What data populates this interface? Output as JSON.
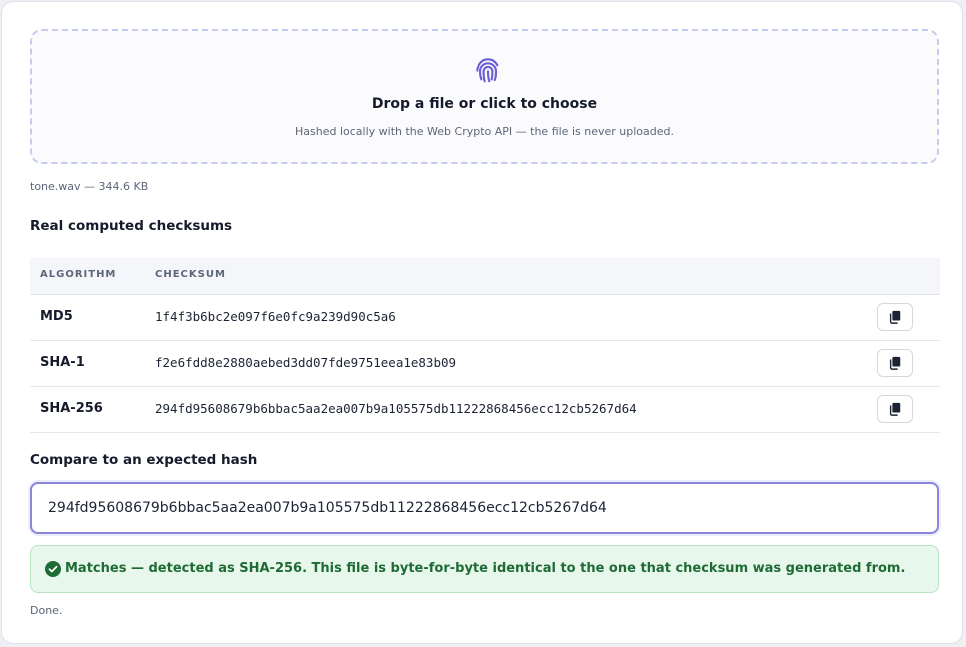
{
  "dropzone": {
    "icon": "fingerprint-icon",
    "title": "Drop a file or click to choose",
    "subtitle": "Hashed locally with the Web Crypto API — the file is never uploaded."
  },
  "file_info": "tone.wav — 344.6 KB",
  "checksums": {
    "title": "Real computed checksums",
    "columns": [
      "ALGORITHM",
      "CHECKSUM"
    ],
    "rows": [
      {
        "algorithm": "MD5",
        "checksum": "1f4f3b6bc2e097f6e0fc9a239d90c5a6",
        "copy_icon": "copy-icon"
      },
      {
        "algorithm": "SHA-1",
        "checksum": "f2e6fdd8e2880aebed3dd07fde9751eea1e83b09",
        "copy_icon": "copy-icon"
      },
      {
        "algorithm": "SHA-256",
        "checksum": "294fd95608679b6bbac5aa2ea007b9a105575db11222868456ecc12cb5267d64",
        "copy_icon": "copy-icon"
      }
    ]
  },
  "compare": {
    "title": "Compare to an expected hash",
    "value": "294fd95608679b6bbac5aa2ea007b9a105575db11222868456ecc12cb5267d64"
  },
  "result": {
    "icon": "check-circle-icon",
    "text": "Matches — detected as SHA-256. This file is byte-for-byte identical to the one that checksum was generated from."
  },
  "status": "Done.",
  "colors": {
    "accent": "#8a86dc",
    "icon_purple": "#6c5fd6",
    "success_bg": "#e8f7ec",
    "success_text": "#1e6b34"
  }
}
